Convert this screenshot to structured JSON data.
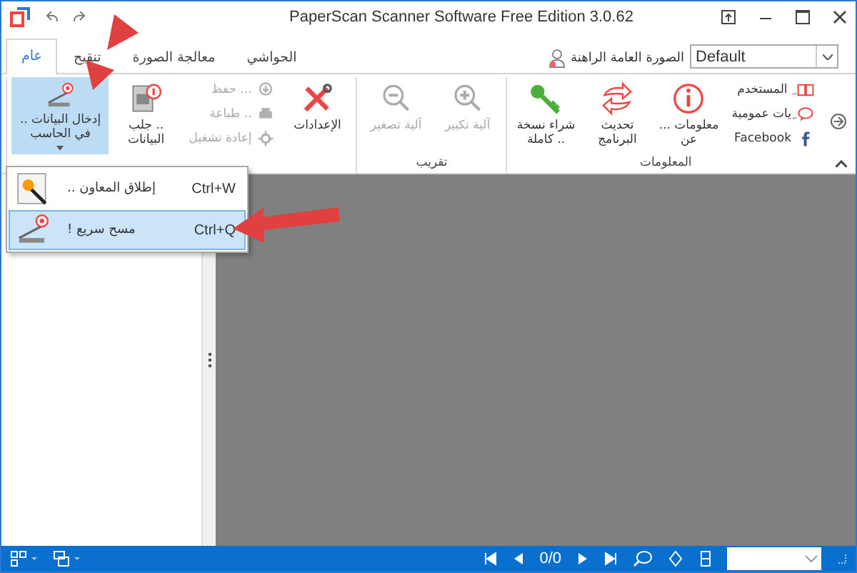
{
  "window": {
    "title": "PaperScan Scanner Software Free Edition 3.0.62"
  },
  "tabs": [
    {
      "label": "الحواشي",
      "selected": false
    },
    {
      "label": "معالجة الصورة",
      "selected": false
    },
    {
      "label": "تنقيح",
      "selected": false
    },
    {
      "label": "عام",
      "selected": true
    }
  ],
  "profile": {
    "label": "الصورة العامة الراهنة",
    "value": "Default"
  },
  "ribbon": [
    {
      "label": "المعلومات",
      "items": [
        {
          "kind": "column",
          "entries": [
            {
              "label": "ِ المستخدم"
            },
            {
              "label": "ِيات عمومية"
            },
            {
              "label": "Facebook"
            }
          ]
        },
        {
          "kind": "big",
          "label": "معلومات ... عن",
          "pressed": false
        },
        {
          "kind": "big",
          "label": "تحديث البرنامج",
          "pressed": false
        },
        {
          "kind": "big",
          "label": "شراء نسخة .. كاملة",
          "pressed": false
        }
      ]
    },
    {
      "label": "تقريب",
      "items": [
        {
          "kind": "big",
          "label": "آلية تكبير",
          "pressed": false,
          "disabled": true
        },
        {
          "kind": "big",
          "label": "آلية تصغير",
          "pressed": false,
          "disabled": true
        }
      ]
    },
    {
      "items": [
        {
          "kind": "big",
          "label": "الإعدادات",
          "pressed": false
        },
        {
          "kind": "column",
          "entries": [
            {
              "label": "... حفظ",
              "disabled": true
            },
            {
              "label": ".. طباعة",
              "disabled": true
            },
            {
              "label": "إعادة تشغيل",
              "disabled": true
            }
          ]
        },
        {
          "kind": "big",
          "label": ".. جلب البيانات",
          "pressed": false
        },
        {
          "kind": "dropdown",
          "label": "إدخال البيانات .. في الحاسب",
          "pressed": true
        }
      ]
    }
  ],
  "menu": [
    {
      "label": ".. إطلاق المعاون",
      "shortcut": "Ctrl+W",
      "selected": false
    },
    {
      "label": "! مسح سريع",
      "shortcut": "Ctrl+Q",
      "selected": true
    }
  ],
  "status_bar": {
    "page": "0/0"
  }
}
